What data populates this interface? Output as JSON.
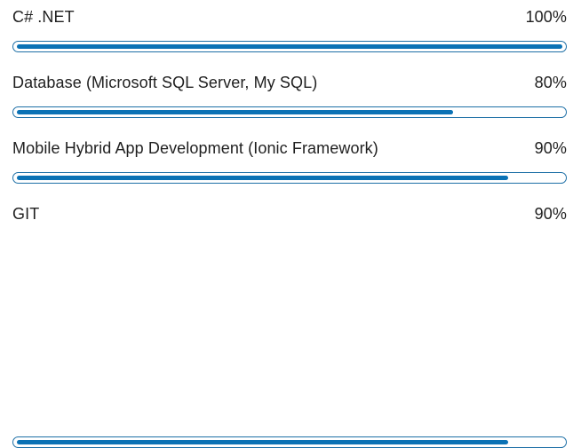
{
  "skills": [
    {
      "label": "C# .NET",
      "percent_text": "100%",
      "level": 1.0
    },
    {
      "label": "Database (Microsoft SQL Server, My SQL)",
      "percent_text": "80%",
      "level": 0.8
    },
    {
      "label": "Mobile Hybrid App Development (Ionic Framework)",
      "percent_text": "90%",
      "level": 0.9
    },
    {
      "label": "GIT",
      "percent_text": "90%",
      "level": 0.9
    }
  ],
  "colors": {
    "bar_fill": "#0b72b5",
    "bar_border": "#1d6fa6",
    "text": "#1f1f1f",
    "background": "#ffffff"
  }
}
